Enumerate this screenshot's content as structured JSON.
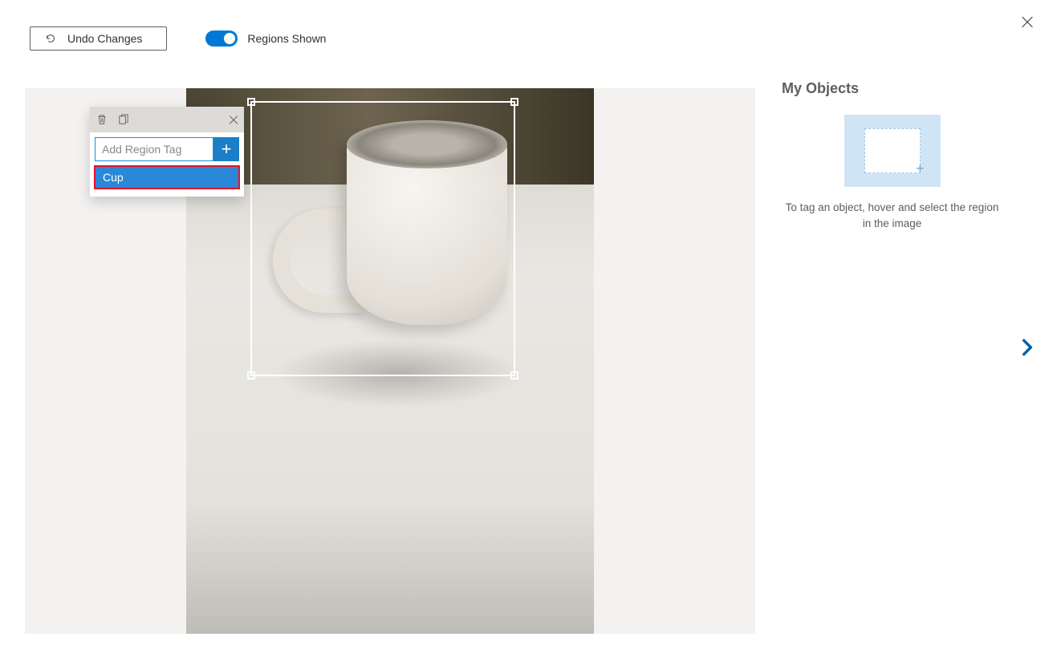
{
  "toolbar": {
    "undo_label": "Undo Changes",
    "regions_label": "Regions Shown",
    "regions_on": true
  },
  "tag_panel": {
    "placeholder": "Add Region Tag",
    "suggestions": [
      "Cup"
    ]
  },
  "sidebar": {
    "title": "My Objects",
    "hint": "To tag an object, hover and select the region in the image"
  }
}
